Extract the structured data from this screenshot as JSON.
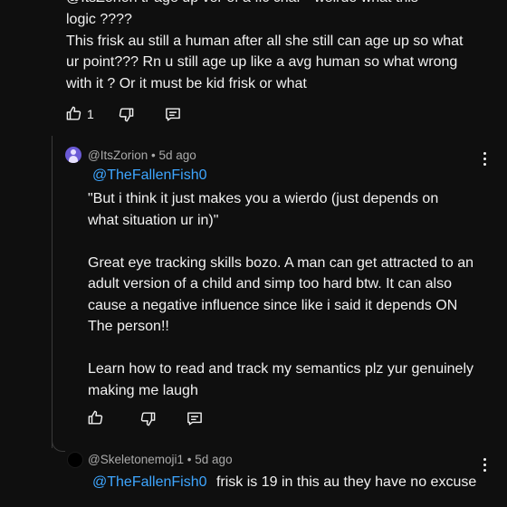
{
  "comment_parent": {
    "cut_line": "@ItsZorion tr age up ver of a fic char - weirdo what this",
    "lines": [
      "logic ????",
      "This frisk au still a human after all she still can age up so what",
      "ur point??? Rn u still age up like a avg human so what wrong",
      "with it ? Or it must be kid frisk or what"
    ],
    "like_count": "1"
  },
  "reply1": {
    "author": "@ItsZorion",
    "sep": "•",
    "time": "5d ago",
    "mention": "@TheFallenFish0",
    "lines": [
      "\"But i think it just makes you a wierdo (just depends on",
      "what situation ur in)\"",
      "",
      "Great eye tracking skills bozo. A man can get attracted to an",
      "adult version of a child and simp too hard btw. It can also",
      "cause a negative influence since like i said it depends ON",
      "The person!!",
      "",
      "Learn how to read and track my semantics plz yur genuinely",
      "making me laugh"
    ],
    "avatar_color": "#6b5bd6"
  },
  "reply2": {
    "author": "@Skeletonemoji1",
    "sep": "•",
    "time": "5d ago",
    "mention": "@TheFallenFish0",
    "text": "frisk is 19 in this au they have no excuse",
    "avatar_color": "#000000"
  },
  "icons": {
    "like": "thumbs-up-icon",
    "dislike": "thumbs-down-icon",
    "reply": "reply-comment-icon",
    "more": "more-vert-icon"
  }
}
